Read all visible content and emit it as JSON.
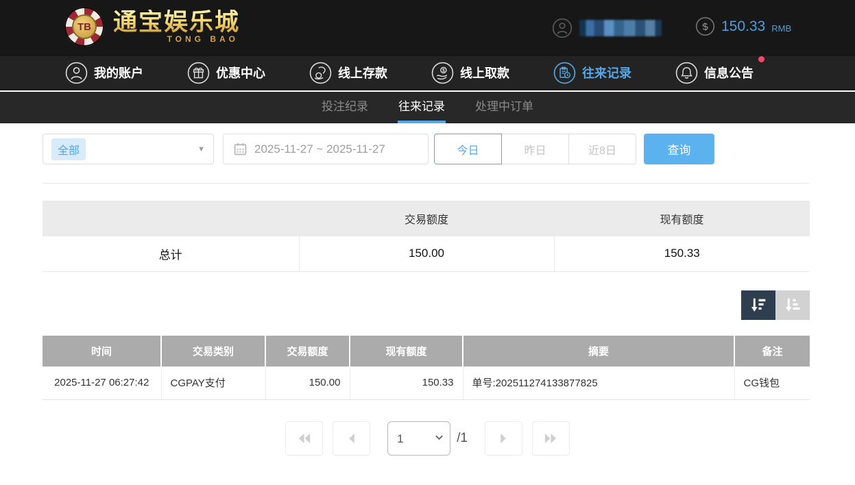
{
  "brand": {
    "chip_label": "TB",
    "name": "通宝娱乐城",
    "name_en": "TONG BAO"
  },
  "account": {
    "balance": "150.33",
    "currency": "RMB"
  },
  "nav": {
    "items": [
      {
        "label": "我的账户"
      },
      {
        "label": "优惠中心"
      },
      {
        "label": "线上存款"
      },
      {
        "label": "线上取款"
      },
      {
        "label": "往来记录"
      },
      {
        "label": "信息公告"
      }
    ],
    "active": "往来记录"
  },
  "subtabs": {
    "items": [
      {
        "label": "投注纪录"
      },
      {
        "label": "往来记录"
      },
      {
        "label": "处理中订单"
      }
    ],
    "active": "往来记录"
  },
  "filters": {
    "type": {
      "selected": "全部",
      "caret": "▼"
    },
    "date_range": "2025-11-27 ~ 2025-11-27",
    "quick": [
      {
        "label": "今日"
      },
      {
        "label": "昨日"
      },
      {
        "label": "近8日"
      }
    ],
    "active_quick": "今日",
    "query_label": "查询"
  },
  "summary": {
    "col_transaction": "交易额度",
    "col_balance": "现有额度",
    "row_label": "总计",
    "transaction_total": "150.00",
    "balance_total": "150.33"
  },
  "records": {
    "headers": [
      "时间",
      "交易类别",
      "交易额度",
      "现有额度",
      "摘要",
      "备注"
    ],
    "rows": [
      {
        "time": "2025-11-27 06:27:42",
        "type": "CGPAY支付",
        "amount": "150.00",
        "balance": "150.33",
        "summary": "单号:202511274133877825",
        "note": "CG钱包"
      }
    ]
  },
  "pagination": {
    "page": "1",
    "total": "/1",
    "caret": "⌄"
  },
  "colors": {
    "accent_blue": "#54a8e8",
    "query_button": "#5bb2ef",
    "balance_text": "#4a9fe0",
    "notification_dot": "#f5476b",
    "records_header_bg": "#ababab",
    "summary_header_bg": "#ebebeb",
    "sort_active_bg": "#2f3e4e",
    "sort_inactive_bg": "#d2d2d2",
    "header_bg": "#171717",
    "nav_bg": "#232323",
    "subtab_bg": "#282828"
  }
}
